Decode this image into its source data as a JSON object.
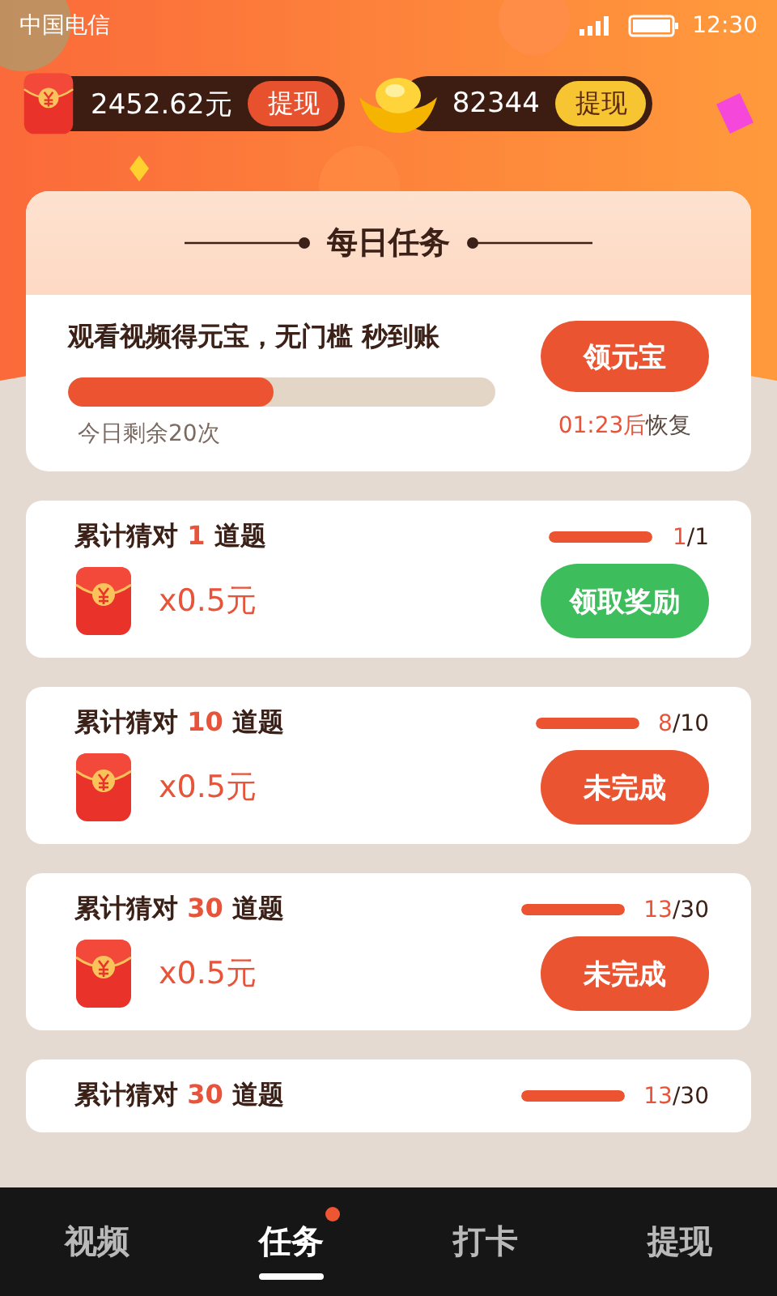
{
  "status_bar": {
    "carrier": "中国电信",
    "time": "12:30"
  },
  "balances": [
    {
      "kind": "cash",
      "amount": "2452.62元",
      "button": "提现"
    },
    {
      "kind": "ingot",
      "amount": "82344",
      "button": "提现"
    }
  ],
  "daily_task": {
    "title": "每日任务",
    "task": "观看视频得元宝，无门槛 秒到账",
    "level": 0.48,
    "remaining": "今日剩余20次",
    "button": "领元宝",
    "countdown": "01:23后",
    "restore_label": "恢复"
  },
  "tasks": [
    {
      "title": "累计猜对 *1* 道题",
      "level": 1,
      "done": "1",
      "total": "/1",
      "reward": "x0.5元",
      "button": "领取奖励",
      "kind": "claimable"
    },
    {
      "title": "累计猜对 *10* 道题",
      "level": 1,
      "done": "8",
      "total": "/10",
      "reward": "x0.5元",
      "button": "未完成",
      "kind": "incomplete"
    },
    {
      "title": "累计猜对 *30* 道题",
      "level": 1,
      "done": "13",
      "total": "/30",
      "reward": "x0.5元",
      "button": "未完成",
      "kind": "incomplete"
    },
    {
      "title": "累计猜对 *30* 道题",
      "level": 1,
      "done": "13",
      "total": "/30",
      "kind": "partial"
    }
  ],
  "nav": [
    {
      "label": "视频",
      "selected": false,
      "badge": false
    },
    {
      "label": "任务",
      "selected": true,
      "badge": true
    },
    {
      "label": "打卡",
      "selected": false,
      "badge": false
    },
    {
      "label": "提现",
      "selected": false,
      "badge": false
    }
  ]
}
